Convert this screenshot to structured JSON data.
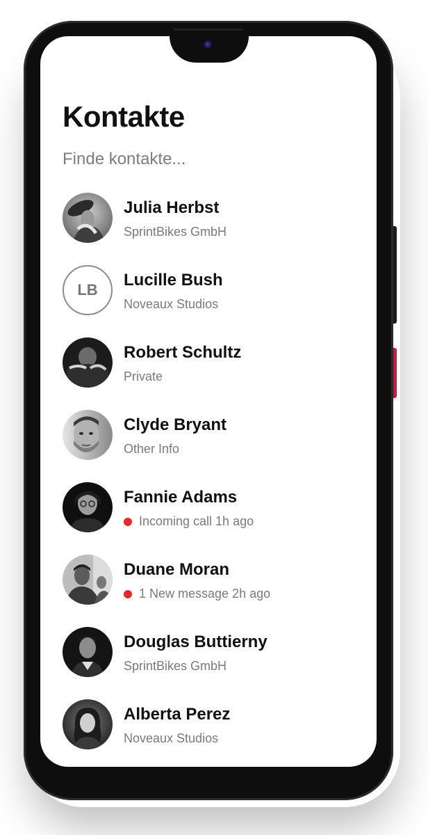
{
  "header": {
    "title": "Kontakte"
  },
  "search": {
    "placeholder": "Finde kontakte..."
  },
  "contacts": [
    {
      "name": "Julia Herbst",
      "subtitle": "SprintBikes GmbH",
      "unread": false,
      "avatar": "photo"
    },
    {
      "name": "Lucille Bush",
      "subtitle": "Noveaux Studios",
      "unread": false,
      "avatar": "initials",
      "initials": "LB"
    },
    {
      "name": "Robert Schultz",
      "subtitle": "Private",
      "unread": false,
      "avatar": "photo"
    },
    {
      "name": "Clyde Bryant",
      "subtitle": "Other Info",
      "unread": false,
      "avatar": "photo"
    },
    {
      "name": "Fannie Adams",
      "subtitle": "Incoming call 1h ago",
      "unread": true,
      "avatar": "photo"
    },
    {
      "name": "Duane Moran",
      "subtitle": "1 New message 2h ago",
      "unread": true,
      "avatar": "photo"
    },
    {
      "name": "Douglas Buttierny",
      "subtitle": "SprintBikes GmbH",
      "unread": false,
      "avatar": "photo"
    },
    {
      "name": "Alberta Perez",
      "subtitle": "Noveaux Studios",
      "unread": false,
      "avatar": "photo"
    }
  ],
  "colors": {
    "unread_dot": "#e8272b",
    "title": "#111111",
    "subtitle": "#7a7a7a",
    "power_button": "#d8254e"
  }
}
